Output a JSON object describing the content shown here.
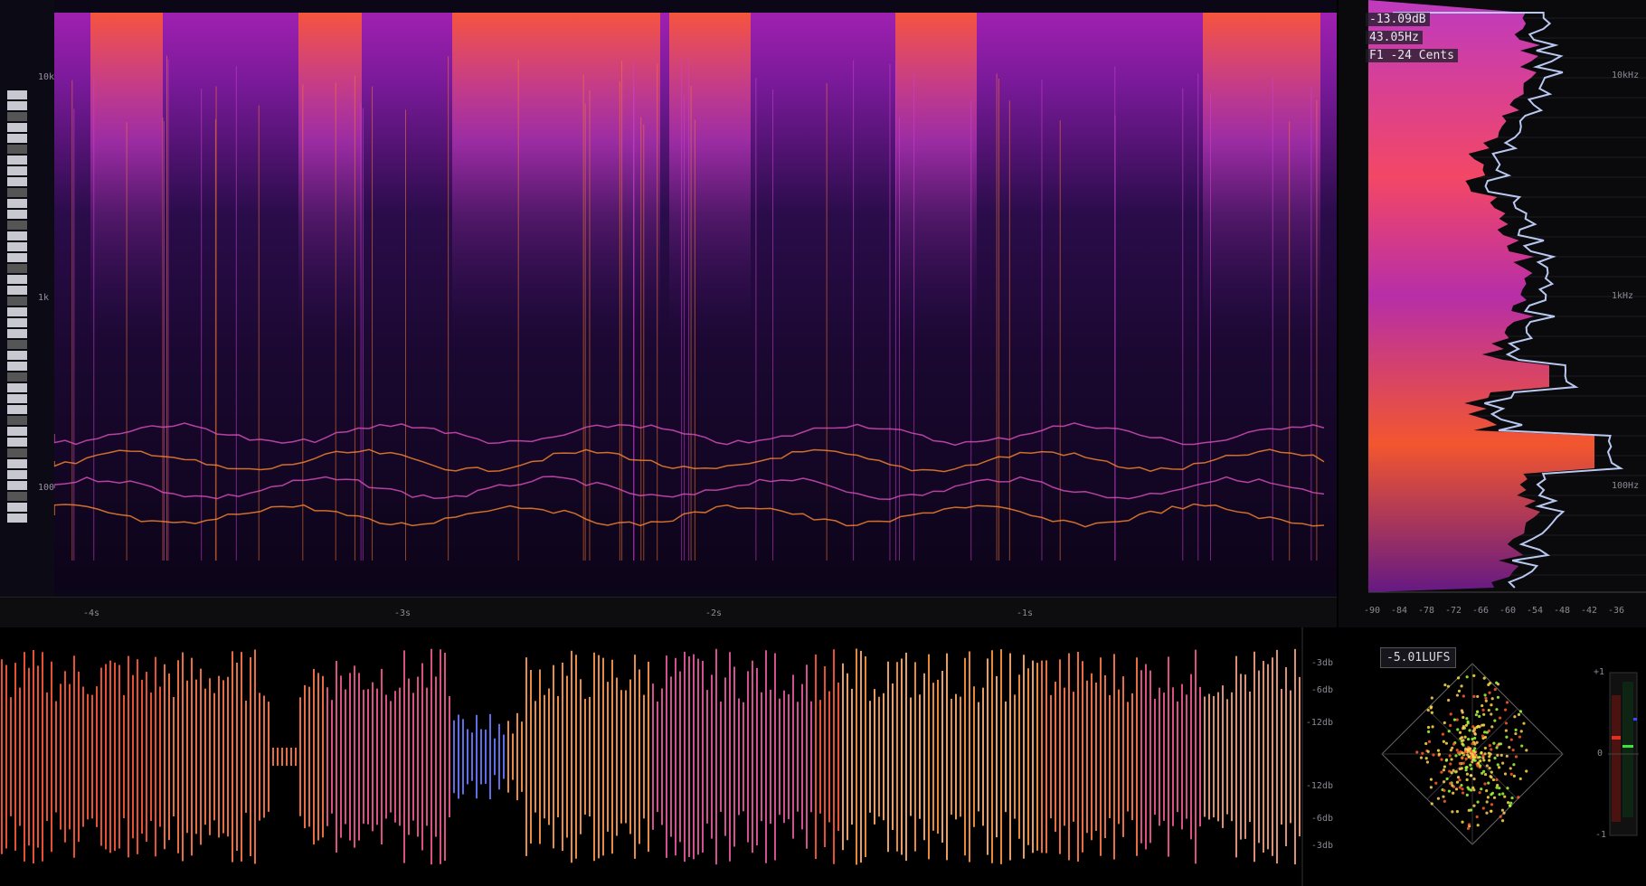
{
  "spectrogram": {
    "freq_labels": [
      "10k",
      "1k",
      "100"
    ],
    "time_labels": [
      "-4s",
      "-3s",
      "-2s",
      "-1s"
    ]
  },
  "spectrum": {
    "readout": {
      "level": "-13.09dB",
      "frequency": "43.05Hz",
      "note": "F1  -24 Cents"
    },
    "freq_labels": [
      "10kHz",
      "1kHz",
      "100Hz"
    ],
    "db_axis": [
      "-90",
      "-84",
      "-78",
      "-72",
      "-66",
      "-60",
      "-54",
      "-48",
      "-42",
      "-36"
    ]
  },
  "waveform": {
    "db_labels": [
      "-3db",
      "-6db",
      "-12db",
      "-12db",
      "-6db",
      "-3db"
    ]
  },
  "analysis": {
    "lufs": "-5.01LUFS",
    "correlation_labels": [
      "+1",
      "0",
      "-1"
    ]
  },
  "colors": {
    "accent_orange": "#ff6a2a",
    "accent_magenta": "#c23cc8",
    "background": "#0b0716"
  }
}
